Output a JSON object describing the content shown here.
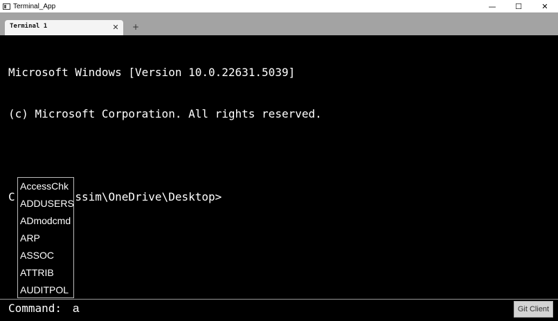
{
  "window": {
    "title": "Terminal_App",
    "controls": {
      "minimize": "—",
      "maximize": "☐",
      "close": "✕"
    }
  },
  "tabs": {
    "items": [
      {
        "label": "Terminal 1",
        "close_glyph": "✕"
      }
    ],
    "new_tab_glyph": "+"
  },
  "terminal": {
    "lines": [
      "Microsoft Windows [Version 10.0.22631.5039]",
      "(c) Microsoft Corporation. All rights reserved.",
      "",
      "C:\\Users\\nssim\\OneDrive\\Desktop>"
    ]
  },
  "autocomplete": {
    "items": [
      "AccessChk",
      "ADDUSERS",
      "ADmodcmd",
      "ARP",
      "ASSOC",
      "ATTRIB",
      "AUDITPOL"
    ]
  },
  "command_bar": {
    "label": "Command:",
    "value": "a",
    "git_button_label": "Git Client"
  },
  "colors": {
    "background": "#000000",
    "text": "#ffffff",
    "tabstrip": "#a3a3a3",
    "active_tab": "#f4f4f4"
  }
}
